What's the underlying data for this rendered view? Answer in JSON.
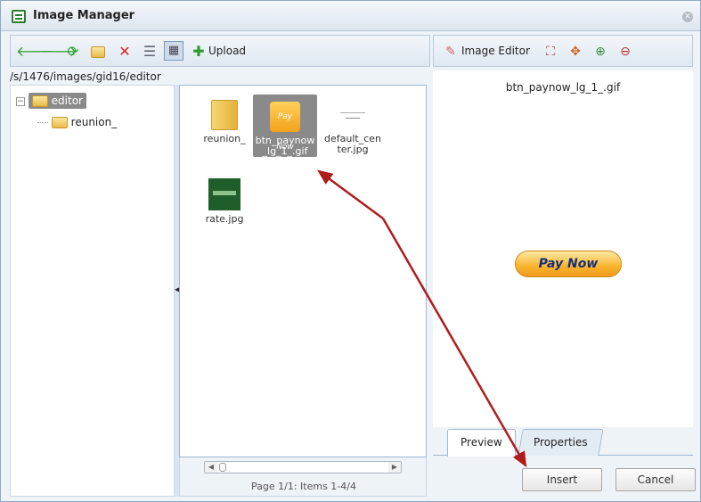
{
  "window": {
    "title": "Image Manager"
  },
  "toolbar": {
    "upload_label": "Upload",
    "editor_label": "Image Editor"
  },
  "path": "/s/1476/images/gid16/editor",
  "tree": {
    "root": "editor",
    "child": "reunion_"
  },
  "files": [
    {
      "name": "reunion_",
      "type": "folder"
    },
    {
      "name": "btn_paynow_lg_1_.gif",
      "type": "image",
      "selected": true,
      "thumb_text": "Pay Now"
    },
    {
      "name": "default_center.jpg",
      "type": "image"
    },
    {
      "name": "rate.jpg",
      "type": "image"
    }
  ],
  "pager": {
    "text": "Page 1/1: Items 1-4/4"
  },
  "editor": {
    "filename": "btn_paynow_lg_1_.gif",
    "preview_label": "Pay Now"
  },
  "tabs": {
    "preview": "Preview",
    "properties": "Properties"
  },
  "actions": {
    "insert": "Insert",
    "cancel": "Cancel"
  },
  "colors": {
    "accent_border": "#9fb7cf",
    "annotation_arrow": "#b01c1c",
    "selected_bg": "#8a8a8a"
  }
}
